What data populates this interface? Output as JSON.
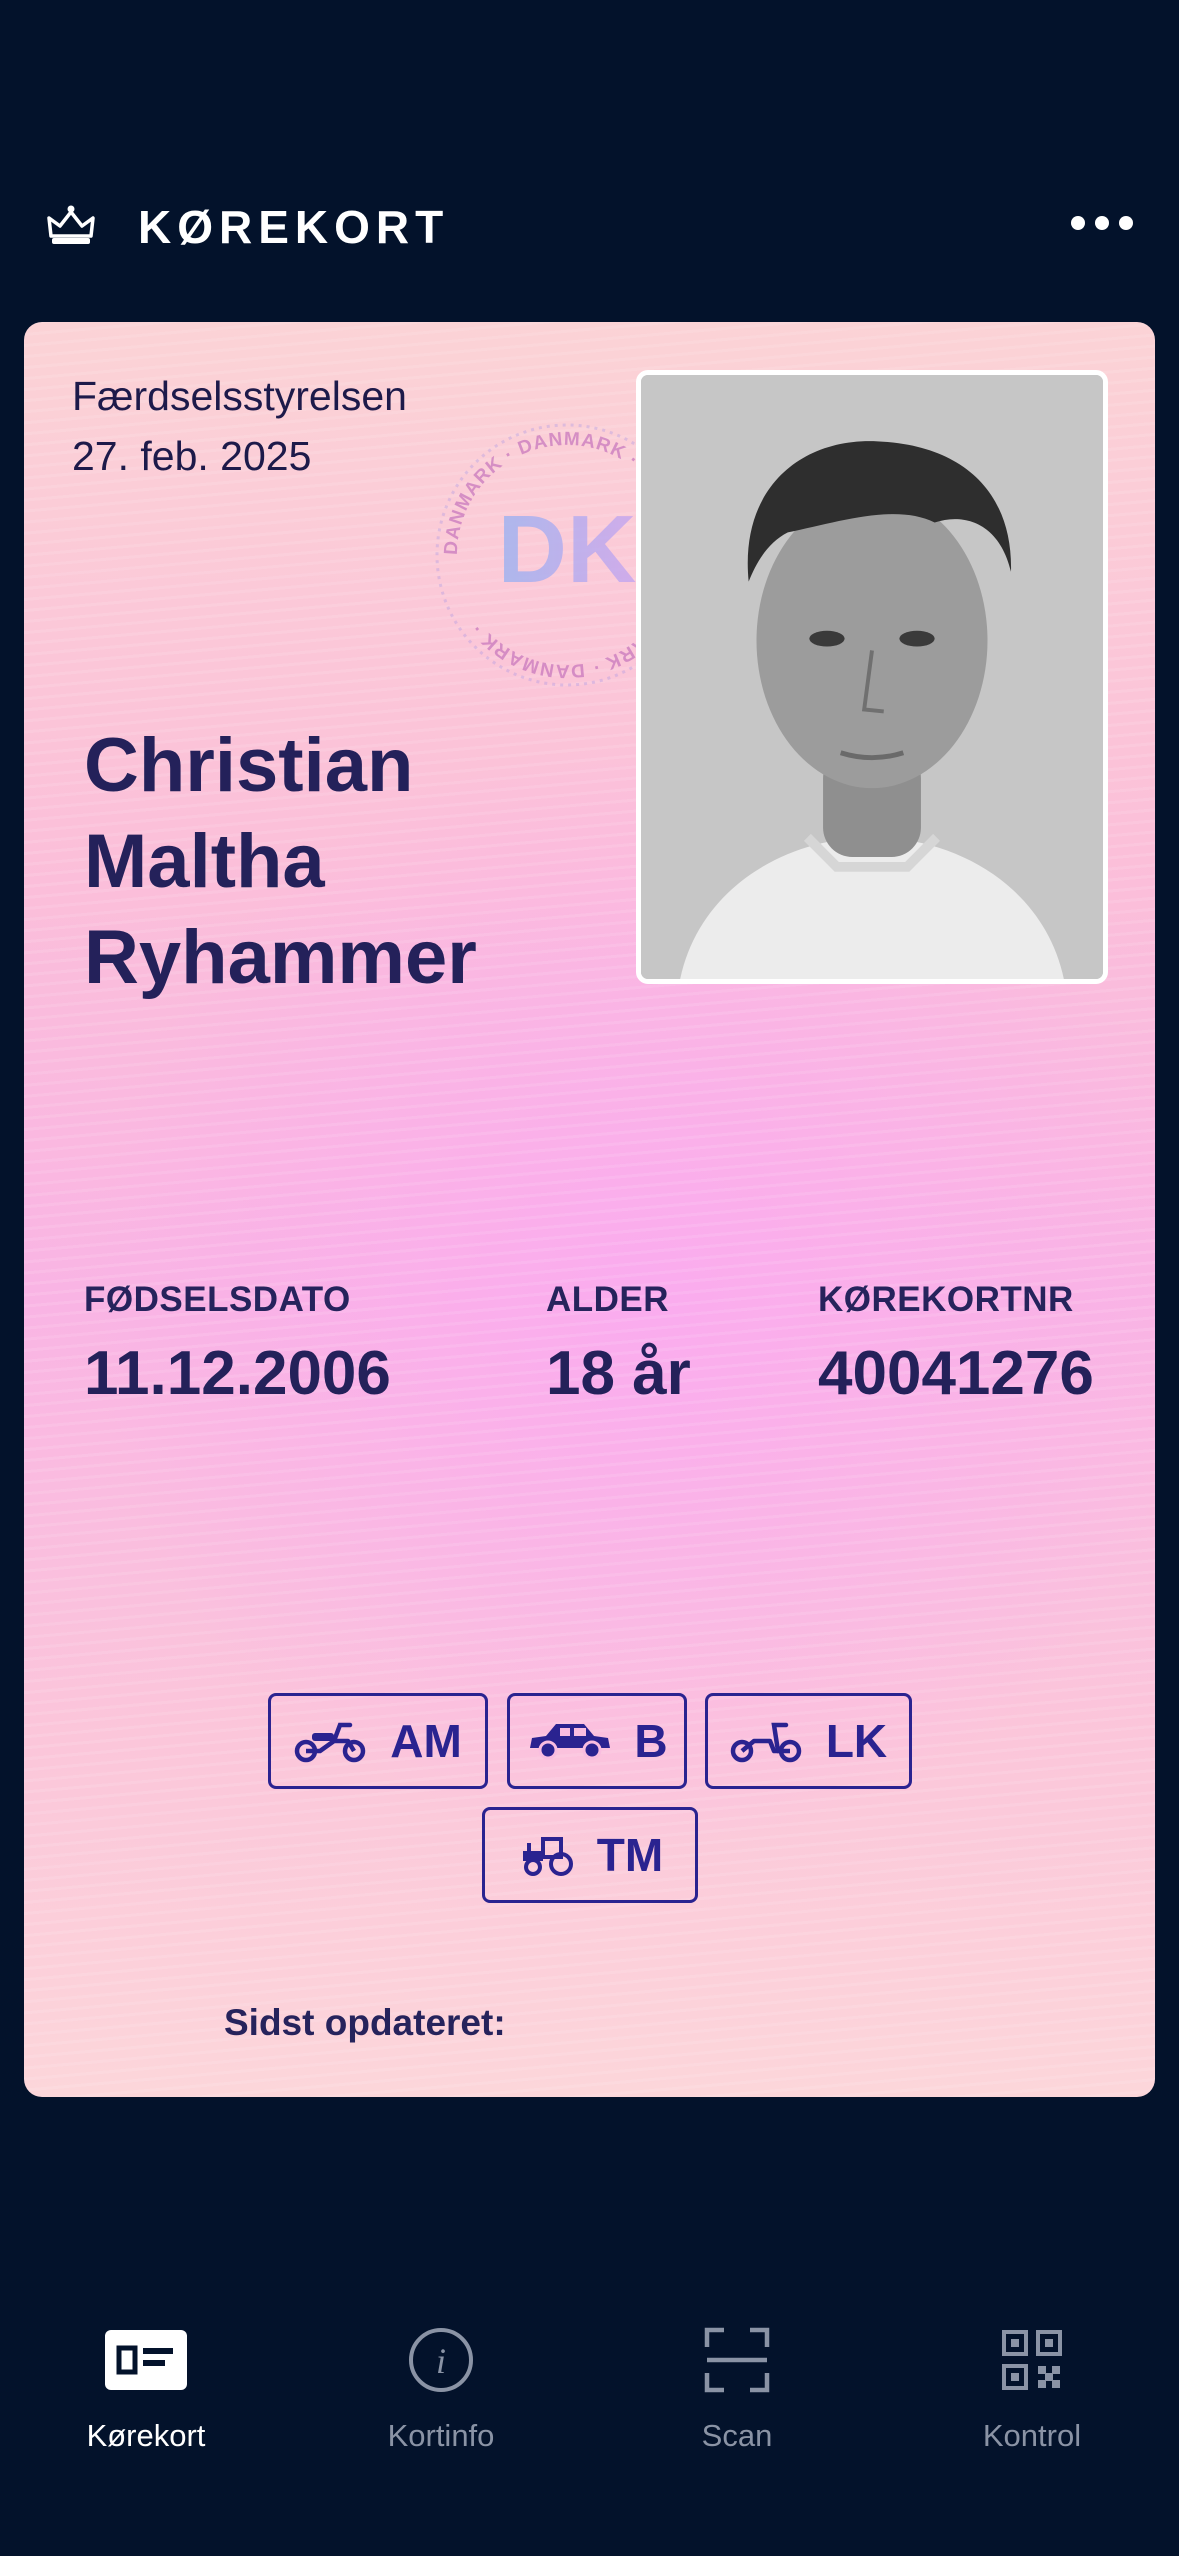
{
  "header": {
    "title": "KØREKORT"
  },
  "card": {
    "issuer": "Færdselsstyrelsen",
    "issue_date": "27. feb. 2025",
    "seal": {
      "ring_text": "DANMARK",
      "center_text": "DK"
    },
    "name_lines": [
      "Christian",
      "Maltha",
      "Ryhammer"
    ],
    "fields": [
      {
        "label": "FØDSELSDATO",
        "value": "11.12.2006"
      },
      {
        "label": "ALDER",
        "value": "18 år"
      },
      {
        "label": "KØREKORTNR",
        "value": "40041276"
      }
    ],
    "categories": [
      {
        "code": "AM",
        "icon": "moped-icon"
      },
      {
        "code": "B",
        "icon": "car-icon"
      },
      {
        "code": "LK",
        "icon": "scooter-icon"
      },
      {
        "code": "TM",
        "icon": "tractor-icon"
      }
    ],
    "last_updated_label": "Sidst opdateret:"
  },
  "nav": {
    "items": [
      {
        "label": "Kørekort",
        "icon": "license-card-icon",
        "active": true
      },
      {
        "label": "Kortinfo",
        "icon": "info-icon",
        "active": false
      },
      {
        "label": "Scan",
        "icon": "scan-icon",
        "active": false
      },
      {
        "label": "Kontrol",
        "icon": "qr-code-icon",
        "active": false
      }
    ]
  },
  "colors": {
    "background": "#03122b",
    "card_text": "#24215a",
    "badge": "#2a2390",
    "nav_inactive": "#8a93a5"
  }
}
